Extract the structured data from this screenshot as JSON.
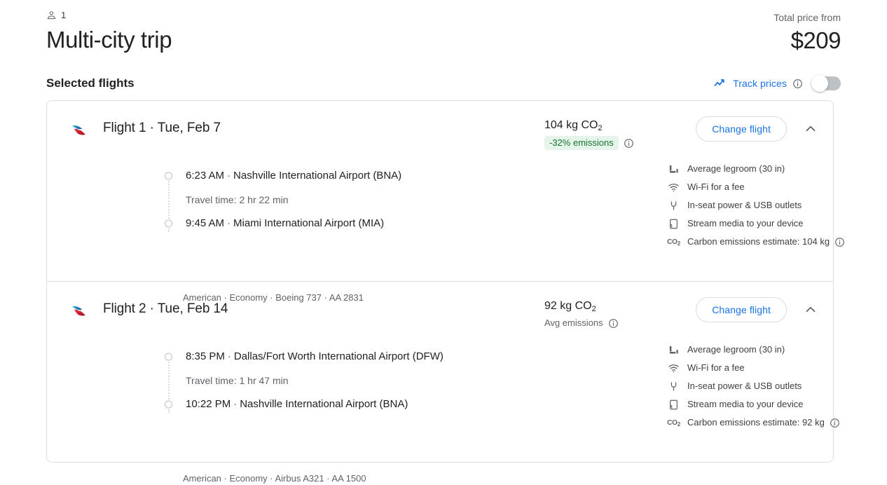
{
  "header": {
    "passenger_icon": "person-icon",
    "passenger_count": "1",
    "title": "Multi-city trip",
    "price_label": "Total price from",
    "price_value": "$209"
  },
  "section": {
    "title": "Selected flights",
    "track_prices": {
      "icon": "trending-up-icon",
      "label": "Track prices",
      "info_icon": "info-icon",
      "toggle_state": "off"
    }
  },
  "colors": {
    "accent_blue": "#1a73e8",
    "badge_green_bg": "#e6f4ea",
    "badge_green_text": "#137333",
    "border": "#dadce0",
    "text_primary": "#202124",
    "text_secondary": "#5f6368",
    "aa_blue": "#0078d2",
    "aa_red": "#d0262f"
  },
  "flights": [
    {
      "airline_logo": "american-airlines-logo",
      "headline": "Flight 1 · Tue, Feb 7",
      "emissions": {
        "amount": "104 kg CO",
        "subscript": "2",
        "badge": "-32% emissions",
        "badge_style": "green",
        "info_icon": "info-icon"
      },
      "change_button": "Change flight",
      "chevron": "chevron-up-icon",
      "departure": {
        "time": "6:23 AM",
        "separator": "·",
        "airport": "Nashville International Airport (BNA)"
      },
      "travel_time": "Travel time: 2 hr 22 min",
      "arrival": {
        "time": "9:45 AM",
        "separator": "·",
        "airport": "Miami International Airport (MIA)"
      },
      "meta": "American · Economy · Boeing 737 · AA 2831",
      "amenities": [
        {
          "icon": "legroom-icon",
          "text": "Average legroom (30 in)"
        },
        {
          "icon": "wifi-icon",
          "text": "Wi-Fi for a fee"
        },
        {
          "icon": "power-plug-icon",
          "text": "In-seat power & USB outlets"
        },
        {
          "icon": "stream-media-icon",
          "text": "Stream media to your device"
        }
      ],
      "carbon_row": {
        "icon": "co2-icon",
        "text": "Carbon emissions estimate: 104 kg",
        "info_icon": "info-icon"
      }
    },
    {
      "airline_logo": "american-airlines-logo",
      "headline": "Flight 2 · Tue, Feb 14",
      "emissions": {
        "amount": "92 kg CO",
        "subscript": "2",
        "badge": "Avg emissions",
        "badge_style": "plain",
        "info_icon": "info-icon"
      },
      "change_button": "Change flight",
      "chevron": "chevron-up-icon",
      "departure": {
        "time": "8:35 PM",
        "separator": "·",
        "airport": "Dallas/Fort Worth International Airport (DFW)"
      },
      "travel_time": "Travel time: 1 hr 47 min",
      "arrival": {
        "time": "10:22 PM",
        "separator": "·",
        "airport": "Nashville International Airport (BNA)"
      },
      "meta": "American · Economy · Airbus A321 · AA 1500",
      "amenities": [
        {
          "icon": "legroom-icon",
          "text": "Average legroom (30 in)"
        },
        {
          "icon": "wifi-icon",
          "text": "Wi-Fi for a fee"
        },
        {
          "icon": "power-plug-icon",
          "text": "In-seat power & USB outlets"
        },
        {
          "icon": "stream-media-icon",
          "text": "Stream media to your device"
        }
      ],
      "carbon_row": {
        "icon": "co2-icon",
        "text": "Carbon emissions estimate: 92 kg",
        "info_icon": "info-icon"
      }
    }
  ]
}
